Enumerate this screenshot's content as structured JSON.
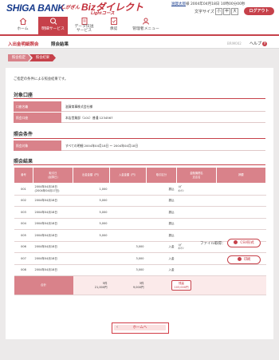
{
  "header": {
    "logo": "SHIGA BANK",
    "service_prefix": "しがぎん",
    "service_name": "Bizダイレクト",
    "service_sub": "Lightコース",
    "user_name": "滋賀太郎",
    "user_suffix": "様",
    "last_login": "2004年04月18日 10時00分00秒",
    "text_size_label": "文字サイズ",
    "text_size_options": [
      "小",
      "中",
      "大"
    ],
    "logout_label": "ログアウト"
  },
  "nav": [
    {
      "label": "ホーム",
      "icon": "home-icon"
    },
    {
      "label": "明細サービス",
      "icon": "search-icon"
    },
    {
      "label": "データ伝送\nサービス",
      "icon": "document-icon"
    },
    {
      "label": "承認",
      "icon": "approve-icon"
    },
    {
      "label": "管理者メニュー",
      "icon": "admin-icon"
    }
  ],
  "titlebar": {
    "section": "入出金明細照会",
    "page": "照会結果",
    "code": "BRIM002",
    "help": "ヘルプ"
  },
  "steps": [
    "照会指定",
    "照会結果"
  ],
  "main": {
    "note": "ご指定の条件による照会結果です。",
    "account_section": "対象口座",
    "account_rows": [
      {
        "key": "口座名義",
        "value": "滋賀商事株式会社様"
      },
      {
        "key": "照会口座",
        "value": "本店営業部（101）普通 1234567"
      }
    ],
    "condition_section": "照会条件",
    "condition_rows": [
      {
        "key": "照会対象",
        "value": "すべての明細 2004年04月18日 〜 2004年04月18日"
      }
    ],
    "result_section": "照会結果",
    "columns": [
      "番号",
      "取引日\n(起算日)",
      "出金金額（円）",
      "入金金額（円）",
      "取引区分",
      "金融機関名\n支店名",
      "摘要"
    ],
    "rows": [
      {
        "no": "001",
        "date": "2004年04月18日\n(2004年04月17日)",
        "out": "1,000",
        "in": "",
        "type": "振込",
        "bank": "ｼｶﾞ\nﾎﾝﾃﾝ",
        "memo": ""
      },
      {
        "no": "002",
        "date": "2004年04月18日",
        "out": "5,000",
        "in": "",
        "type": "振込",
        "bank": "",
        "memo": ""
      },
      {
        "no": "003",
        "date": "2004年04月18日",
        "out": "5,000",
        "in": "",
        "type": "振込",
        "bank": "",
        "memo": ""
      },
      {
        "no": "004",
        "date": "2004年04月18日",
        "out": "5,000",
        "in": "",
        "type": "振込",
        "bank": "",
        "memo": ""
      },
      {
        "no": "005",
        "date": "2004年04月18日",
        "out": "5,000",
        "in": "",
        "type": "振込",
        "bank": "",
        "memo": ""
      },
      {
        "no": "006",
        "date": "2004年04月18日",
        "out": "",
        "in": "3,000",
        "type": "入金",
        "bank": "ｼｶﾞ\nﾎﾝﾃﾝ",
        "memo": ""
      },
      {
        "no": "007",
        "date": "2004年04月18日",
        "out": "",
        "in": "3,000",
        "type": "入金",
        "bank": "",
        "memo": ""
      },
      {
        "no": "008",
        "date": "2004年04月18日",
        "out": "",
        "in": "3,000",
        "type": "入金",
        "bank": "",
        "memo": ""
      }
    ],
    "total": {
      "label": "合計",
      "out_count": "5件",
      "out_amount": "21,000円",
      "in_count": "3件",
      "in_amount": "9,000円",
      "balance_label": "残高",
      "balance_amount": "103,000円"
    },
    "file_label": "ファイル取得：",
    "csv_button": "CSV形式",
    "print_button": "印刷",
    "home_button": "ホームへ"
  },
  "colors": {
    "accent": "#c6414a",
    "brand": "#173b8c",
    "header_cell": "#d9828a"
  }
}
